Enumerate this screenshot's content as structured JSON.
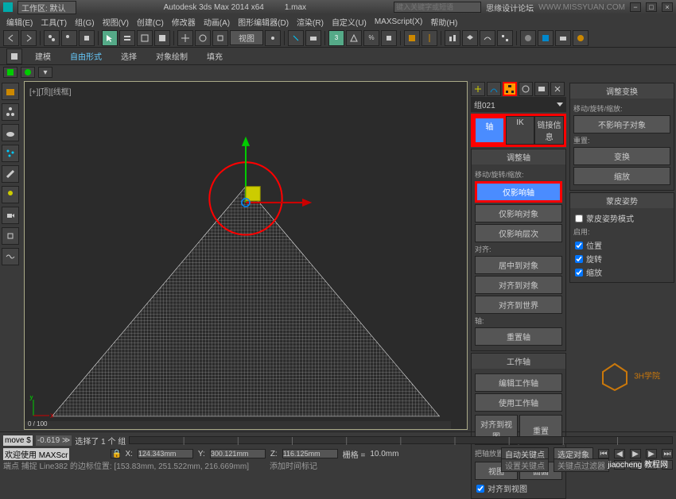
{
  "title": {
    "app": "Autodesk 3ds Max  2014 x64",
    "file": "1.max",
    "workspace_label": "工作区: 默认",
    "search_placeholder": "键入关键字或短语",
    "forum": "思缘设计论坛",
    "url": "WWW.MISSYUAN.COM"
  },
  "menu": [
    "编辑(E)",
    "工具(T)",
    "组(G)",
    "视图(V)",
    "创建(C)",
    "修改器",
    "动画(A)",
    "图形编辑器(D)",
    "渲染(R)",
    "自定义(U)",
    "MAXScript(X)",
    "帮助(H)"
  ],
  "tabs": {
    "ribbon": [
      "建模",
      "自由形式",
      "选择",
      "对象绘制",
      "填充"
    ]
  },
  "viewport": {
    "label": "[+][顶][线框]",
    "scroll": "0 / 100"
  },
  "panel": {
    "group": "组021",
    "tabs": {
      "axis": "轴",
      "ik": "IK",
      "link": "链接信息"
    },
    "adjust_axis": {
      "header": "调整轴",
      "sect1": "移动/旋转/缩放:",
      "b1": "仅影响轴",
      "b2": "仅影响对象",
      "b3": "仅影响层次",
      "sect2": "对齐:",
      "b4": "居中到对象",
      "b5": "对齐到对象",
      "b6": "对齐到世界",
      "sect3": "轴:",
      "b7": "重置轴"
    },
    "work_axis": {
      "header": "工作轴",
      "b1": "编辑工作轴",
      "b2": "使用工作轴",
      "b3": "对齐到视图",
      "b4": "重置",
      "sect": "把轴放置在:",
      "b5": "视图",
      "b6": "曲面",
      "cb": "对齐到视图"
    },
    "adjust_xform": {
      "header": "调整变换",
      "sect1": "移动/旋转/缩放:",
      "b1": "不影响子对象",
      "sect2": "重置:",
      "b2": "变换",
      "b3": "缩放"
    },
    "skin_pose": {
      "header": "蒙皮姿势",
      "cb1": "蒙皮姿势模式",
      "sect": "启用:",
      "cb2": "位置",
      "cb3": "旋转",
      "cb4": "缩放"
    }
  },
  "status": {
    "move": "move $",
    "move_val": "-0.619 ≫",
    "sel": "选择了 1 个 组",
    "x_label": "X:",
    "x": "124.343mm",
    "y_label": "Y:",
    "y": "300.121mm",
    "z_label": "Z:",
    "z": "116.125mm",
    "grid_label": "栅格 =",
    "grid": "10.0mm",
    "autokey": "自动关键点",
    "keyfilter": "选定对象",
    "welcome": "欢迎使用 MAXScr",
    "hint": "端点 捕捉 Line382 的边标位置: [153.83mm, 251.522mm, 216.669mm]",
    "addtime": "添加时间标记",
    "setkey": "设置关键点",
    "keyfilter2": "关键点过滤器"
  },
  "watermark": "3H学院",
  "watermark2": "jiaocheng 教程网"
}
